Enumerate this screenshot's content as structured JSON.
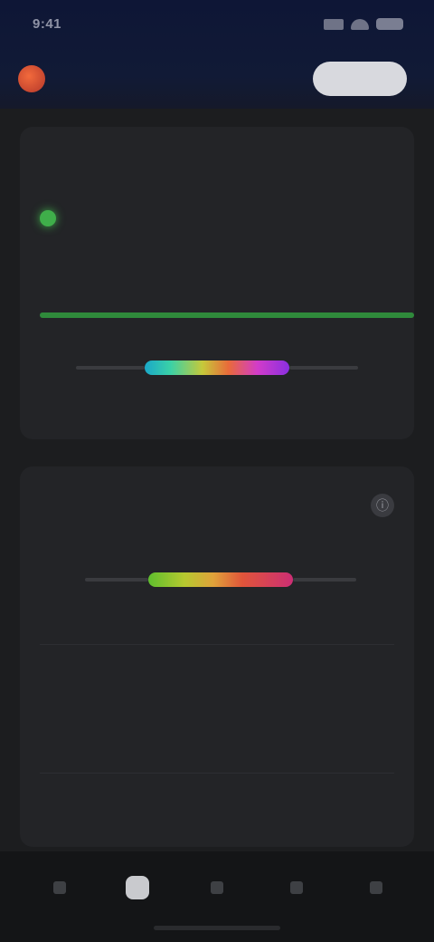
{
  "status_bar": {
    "time": "9:41"
  },
  "header": {
    "app_title": "",
    "action_button_label": "",
    "logo": "app-logo"
  },
  "status_card": {
    "caption": "",
    "status_text": "",
    "status_sub": "",
    "progress": 1.0,
    "progress_caption": "",
    "footer_text": "",
    "status_color": "#3fae4a"
  },
  "detail_card": {
    "title": "",
    "subtitle": "",
    "info_icon": "ⓘ",
    "metrics": [
      {
        "section": "",
        "name": "",
        "sub": "",
        "value": ""
      },
      {
        "section": "",
        "name": "",
        "sub": "",
        "value": ""
      }
    ]
  },
  "bottom_nav": {
    "items": [
      {
        "icon": "home-icon"
      },
      {
        "icon": "dashboard-icon",
        "active": true
      },
      {
        "icon": "chart-icon"
      },
      {
        "icon": "list-icon"
      },
      {
        "icon": "settings-icon"
      }
    ]
  },
  "colors": {
    "header_bg": "#0e1636",
    "card_bg": "#232427",
    "accent_green": "#3fae4a",
    "page_bg": "#1c1d1f"
  }
}
